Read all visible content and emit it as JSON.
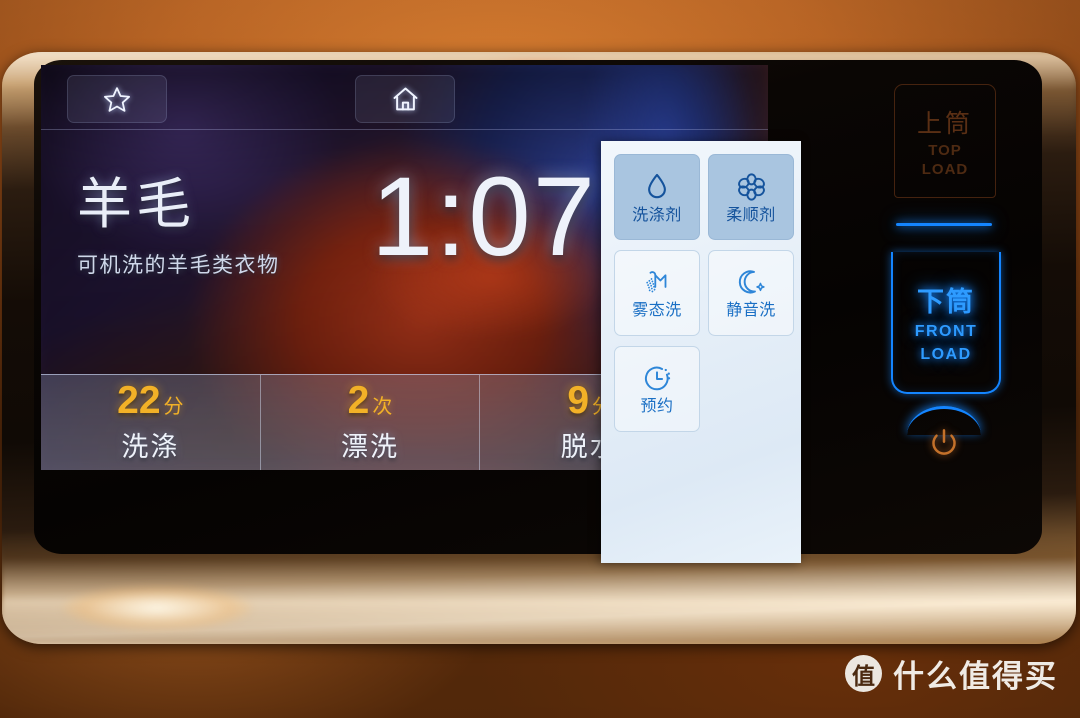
{
  "device": {
    "name": "washing-machine-control-panel",
    "accent_blue": "#1485ff",
    "accent_amber": "#f2b127",
    "panel_option_selected_bg": "#a9c5e0"
  },
  "screen": {
    "topbar": {
      "favorite_icon": "star-icon",
      "home_icon": "home-icon"
    },
    "program": {
      "title": "羊毛",
      "subtitle": "可机洗的羊毛类衣物",
      "remaining_time": "1:07"
    },
    "stats": [
      {
        "value": "22",
        "unit": "分",
        "label": "洗涤"
      },
      {
        "value": "2",
        "unit": "次",
        "label": "漂洗"
      },
      {
        "value": "9",
        "unit": "分",
        "label": "脱水"
      }
    ],
    "stats_more_icon": "chevron-right-icon"
  },
  "options": [
    {
      "label": "洗涤剂",
      "icon": "water-drop-icon",
      "selected": true
    },
    {
      "label": "柔顺剂",
      "icon": "flower-icon",
      "selected": true
    },
    {
      "label": "雾态洗",
      "icon": "shower-mist-icon",
      "selected": false
    },
    {
      "label": "静音洗",
      "icon": "moon-icon",
      "selected": false
    },
    {
      "label": "预约",
      "icon": "clock-timer-icon",
      "selected": false
    }
  ],
  "controls": {
    "top_load": {
      "cn": "上筒",
      "en_line1": "TOP",
      "en_line2": "LOAD",
      "active": false
    },
    "front_load": {
      "cn": "下筒",
      "en_line1": "FRONT",
      "en_line2": "LOAD",
      "active": true
    },
    "power_icon": "power-icon"
  },
  "watermark": {
    "logo_char": "值",
    "text": "什么值得买"
  }
}
